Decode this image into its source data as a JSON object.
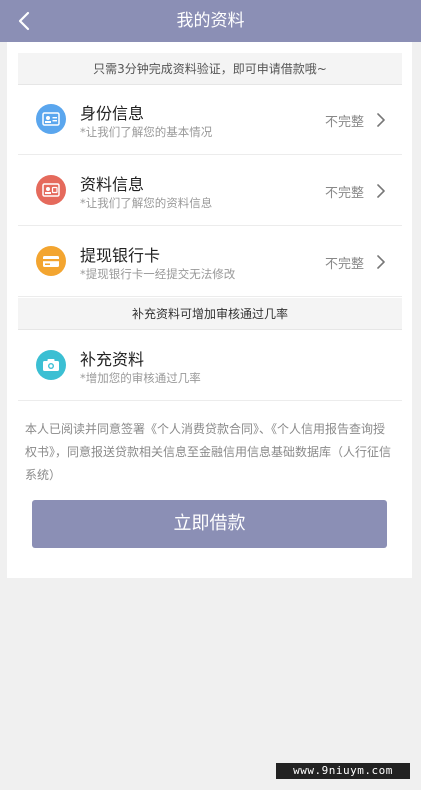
{
  "header": {
    "title": "我的资料"
  },
  "notice": "只需3分钟完成资料验证，即可申请借款哦~",
  "rows": [
    {
      "name": "身份信息",
      "sub": "*让我们了解您的基本情况",
      "status": "不完整",
      "icon": "id-card-icon",
      "color": "#5aa6ee"
    },
    {
      "name": "资料信息",
      "sub": "*让我们了解您的资料信息",
      "status": "不完整",
      "icon": "profile-card-icon",
      "color": "#e56a5c"
    },
    {
      "name": "提现银行卡",
      "sub": "*提现银行卡一经提交无法修改",
      "status": "不完整",
      "icon": "bank-card-icon",
      "color": "#f3a530"
    }
  ],
  "section": "补充资料可增加审核通过几率",
  "supplement": {
    "name": "补充资料",
    "sub": "*增加您的审核通过几率",
    "icon": "camera-icon",
    "color": "#3bbfd3"
  },
  "agreement": "本人已阅读并同意签署《个人消费贷款合同》、《个人信用报告查询授权书》，同意报送贷款相关信息至金融信用信息基础数据库（人行征信系统）",
  "loan_button": "立即借款",
  "watermark": "www.9niuym.com"
}
